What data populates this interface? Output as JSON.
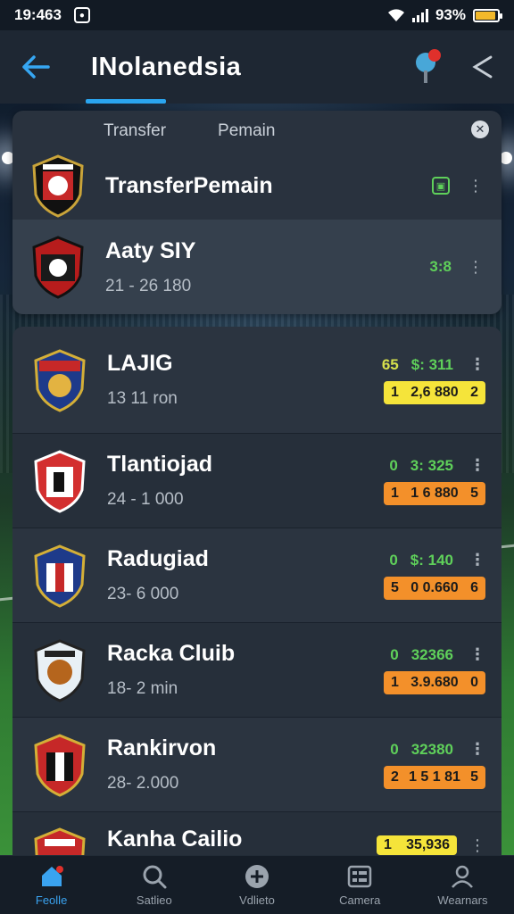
{
  "status_bar": {
    "time": "19:463",
    "battery": "93%"
  },
  "app_bar": {
    "title": "INolanedsia"
  },
  "filter": {
    "tab_1": "Transfer",
    "tab_2": "Pemain"
  },
  "top_card": [
    {
      "name": "TransferPemain"
    },
    {
      "name": "Aaty SIY",
      "sub": "21 - 26 180",
      "stat": "3:8"
    }
  ],
  "clubs": [
    {
      "name": "LAJIG",
      "sub": "13 11 ron",
      "stat_a": "65",
      "stat_b": "$: 311",
      "pill_left": "1",
      "pill_mid": "2,6 880",
      "pill_right": "2",
      "pill_color": "yellow"
    },
    {
      "name": "Tlantiojad",
      "sub": "24 - 1 000",
      "stat_a": "0",
      "stat_b": "3: 325",
      "pill_left": "1",
      "pill_mid": "1 6 880",
      "pill_right": "5",
      "pill_color": "orange"
    },
    {
      "name": "Radugiad",
      "sub": "23- 6 000",
      "stat_a": "0",
      "stat_b": "$: 140",
      "pill_left": "5",
      "pill_mid": "0 0.660",
      "pill_right": "6",
      "pill_color": "orange"
    },
    {
      "name": "Racka Cluib",
      "sub": "18- 2 min",
      "stat_a": "0",
      "stat_b": "32366",
      "pill_left": "1",
      "pill_mid": "3.9.680",
      "pill_right": "0",
      "pill_color": "orange"
    },
    {
      "name": "Rankirvon",
      "sub": "28- 2.000",
      "stat_a": "0",
      "stat_b": "32380",
      "pill_left": "2",
      "pill_mid": "1 5 1 81",
      "pill_right": "5",
      "pill_color": "orange"
    },
    {
      "name": "Kanha Cailio",
      "sub": "",
      "stat_a": "",
      "stat_b": "",
      "pill_left": "1",
      "pill_mid": "35,936",
      "pill_right": "",
      "pill_color": "yellow"
    }
  ],
  "nav": [
    {
      "label": "Feolle"
    },
    {
      "label": "Satlieo"
    },
    {
      "label": "Vdlieto"
    },
    {
      "label": "Camera"
    },
    {
      "label": "Wearnars"
    }
  ],
  "colors": {
    "accent": "#2aa5f0",
    "green": "#5fd05a",
    "yellow": "#f5e43a",
    "orange": "#f3902a"
  }
}
